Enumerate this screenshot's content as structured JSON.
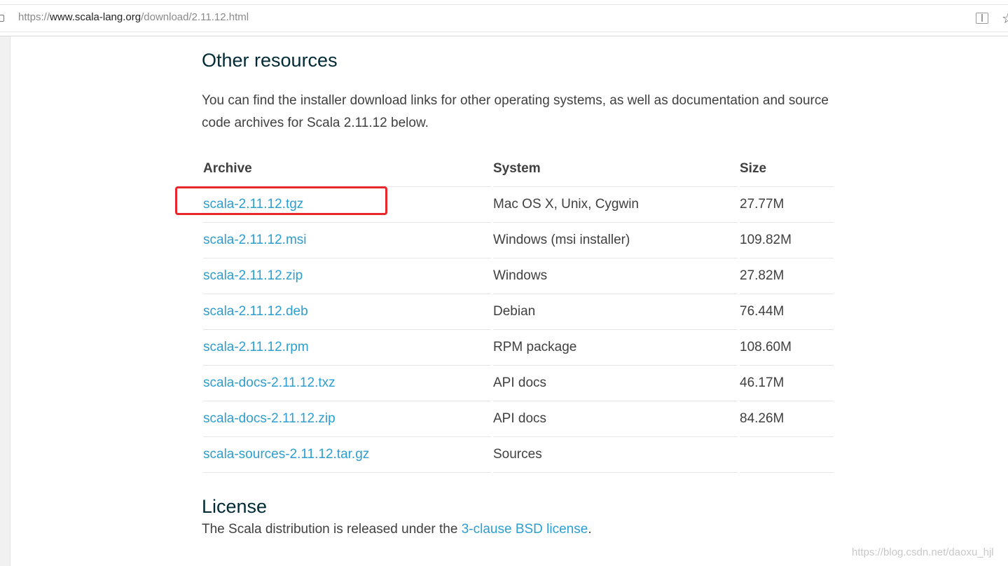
{
  "browser": {
    "url_scheme": "https://",
    "url_host": "www.scala-lang.org",
    "url_path": "/download/2.11.12.html"
  },
  "other_resources": {
    "heading": "Other resources",
    "intro": "You can find the installer download links for other operating systems, as well as documentation and source code archives for Scala 2.11.12 below."
  },
  "table": {
    "headers": [
      "Archive",
      "System",
      "Size"
    ],
    "rows": [
      {
        "archive": "scala-2.11.12.tgz",
        "system": "Mac OS X, Unix, Cygwin",
        "size": "27.77M"
      },
      {
        "archive": "scala-2.11.12.msi",
        "system": "Windows (msi installer)",
        "size": "109.82M"
      },
      {
        "archive": "scala-2.11.12.zip",
        "system": "Windows",
        "size": "27.82M"
      },
      {
        "archive": "scala-2.11.12.deb",
        "system": "Debian",
        "size": "76.44M"
      },
      {
        "archive": "scala-2.11.12.rpm",
        "system": "RPM package",
        "size": "108.60M"
      },
      {
        "archive": "scala-docs-2.11.12.txz",
        "system": "API docs",
        "size": "46.17M"
      },
      {
        "archive": "scala-docs-2.11.12.zip",
        "system": "API docs",
        "size": "84.26M"
      },
      {
        "archive": "scala-sources-2.11.12.tar.gz",
        "system": "Sources",
        "size": ""
      }
    ]
  },
  "license": {
    "heading": "License",
    "text_before": "The Scala distribution is released under the ",
    "link": "3-clause BSD license",
    "text_after": "."
  },
  "watermark": "https://blog.csdn.net/daoxu_hjl",
  "colors": {
    "link": "#2c9ed0",
    "heading": "#002b36",
    "highlight": "#e8262b"
  }
}
